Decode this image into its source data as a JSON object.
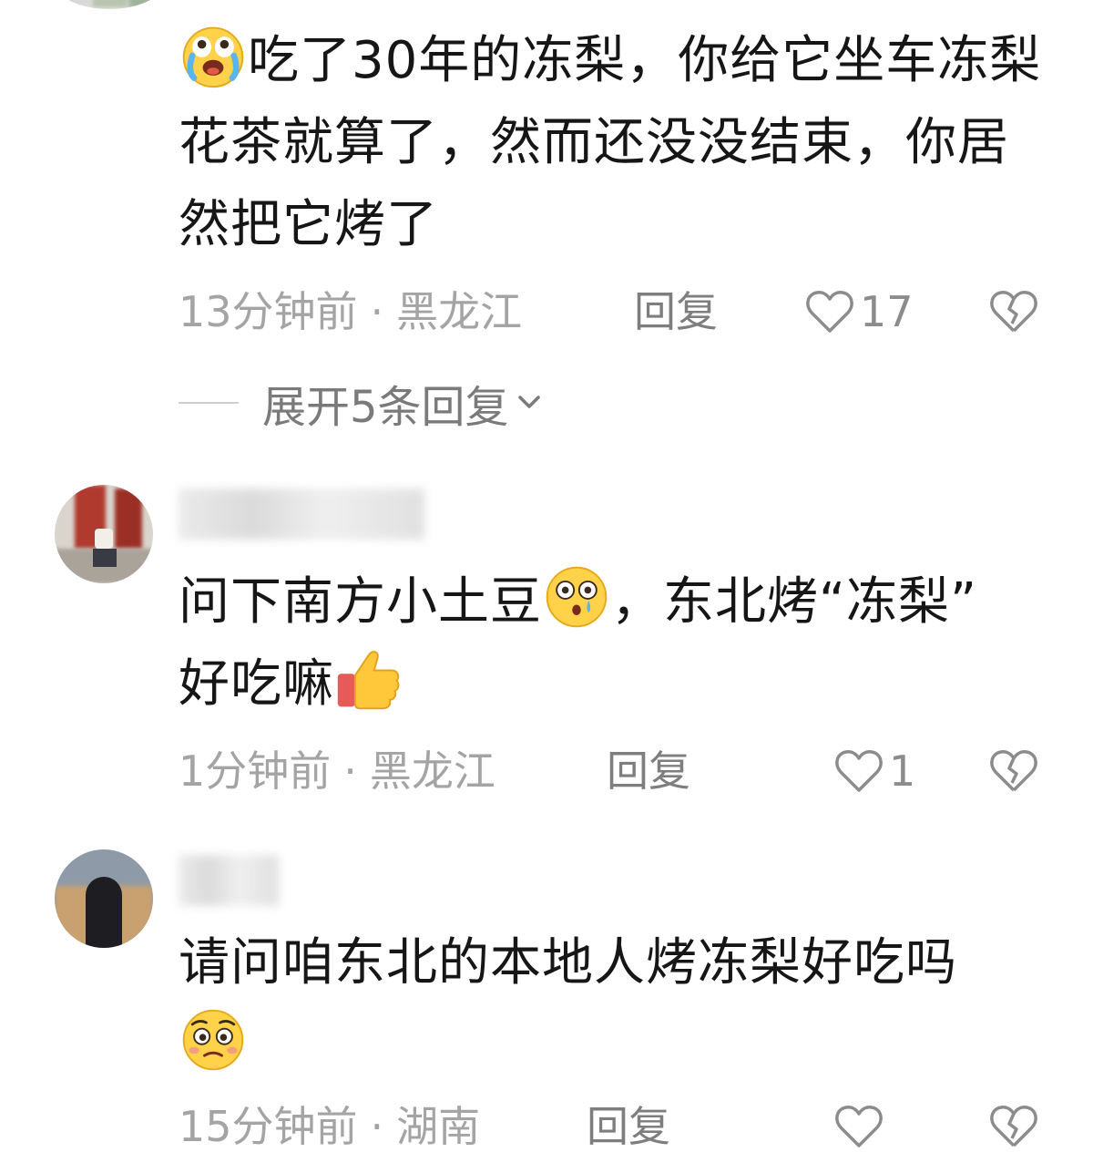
{
  "comments": [
    {
      "text_parts": [
        "吃了30年的冻梨，你给它坐车冻梨花茶就算了，然而还没没结束，你居然把它烤了"
      ],
      "emoji_lead": "crying-laugh-emoji",
      "time": "13分钟前",
      "location": "黑龙江",
      "reply_label": "回复",
      "like_count": "17",
      "expand_label": "展开5条回复"
    },
    {
      "text_a": "问下南方小土豆",
      "text_b": "，东北烤“冻梨”",
      "text_c": "好吃嘛",
      "emoji_mid": "shocked-tear-emoji",
      "emoji_end": "thumbs-up-emoji",
      "time": "1分钟前",
      "location": "黑龙江",
      "reply_label": "回复",
      "like_count": "1"
    },
    {
      "text": "请问咱东北的本地人烤冻梨好吃吗",
      "emoji_end": "pleading-emoji",
      "time": "15分钟前",
      "location": "湖南",
      "reply_label": "回复",
      "like_count": ""
    }
  ],
  "meta_separator": "·",
  "colors": {
    "text": "#161616",
    "meta": "#a4a4a4",
    "icon": "#8c8c8c"
  }
}
